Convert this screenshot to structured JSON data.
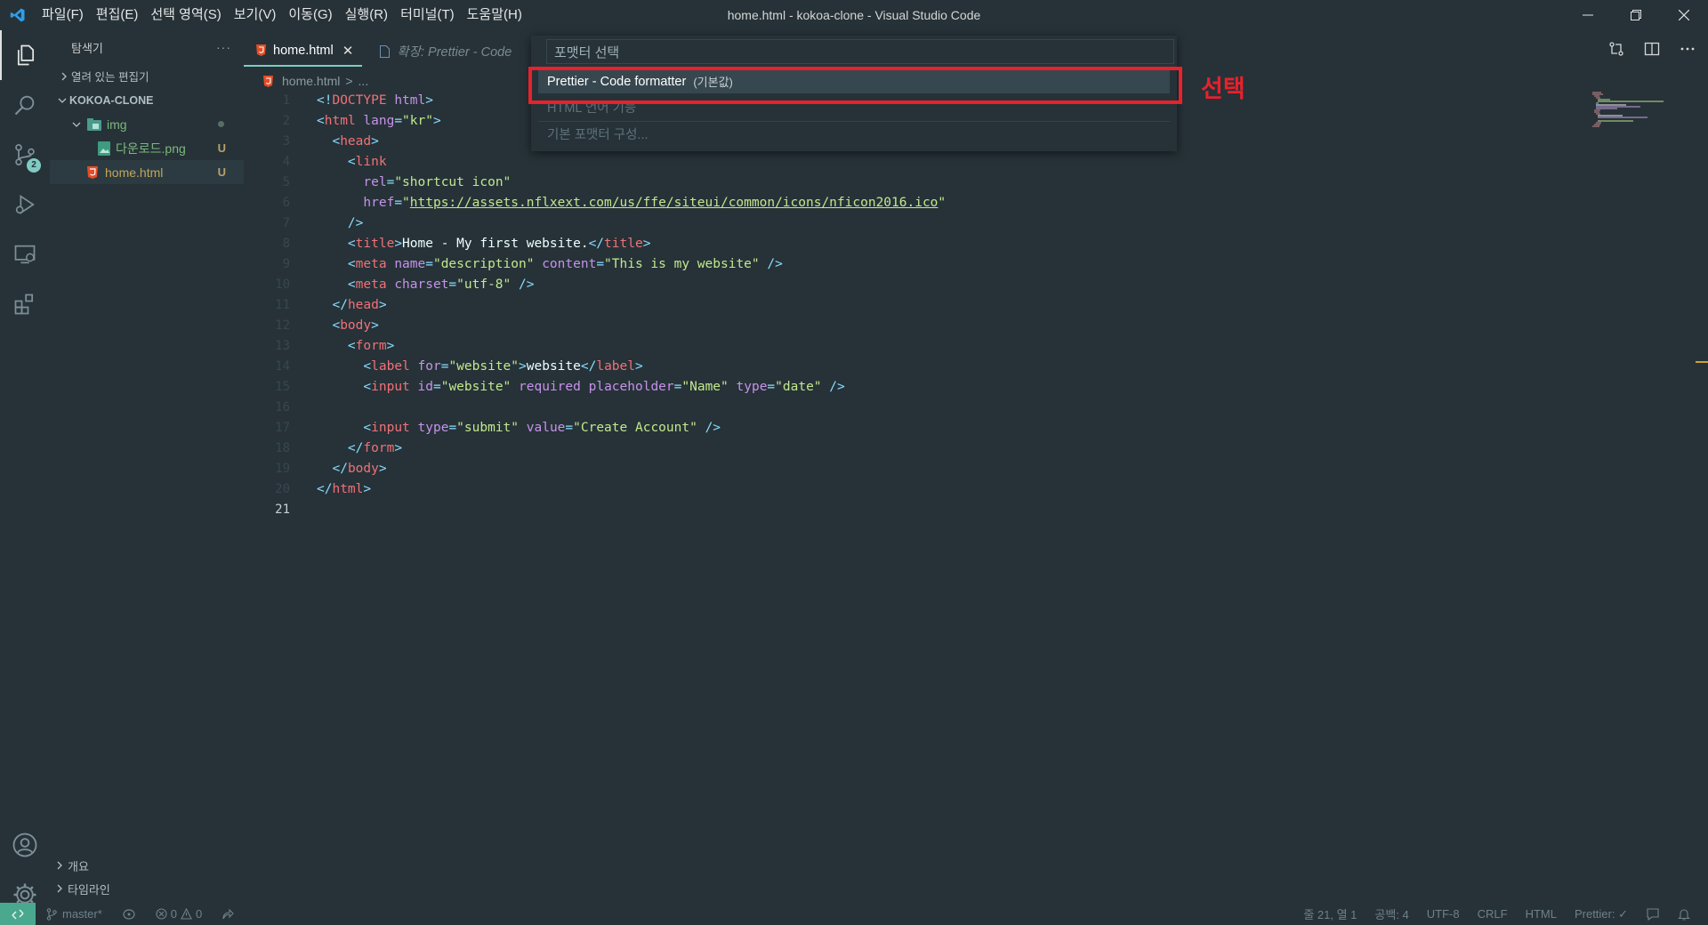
{
  "window": {
    "title": "home.html - kokoa-clone - Visual Studio Code"
  },
  "menu": {
    "items": [
      "파일(F)",
      "편집(E)",
      "선택 영역(S)",
      "보기(V)",
      "이동(G)",
      "실행(R)",
      "터미널(T)",
      "도움말(H)"
    ]
  },
  "activity_bar": {
    "scm_badge": "2"
  },
  "sidebar": {
    "title": "탐색기",
    "more": "···",
    "open_editors": "열려 있는 편집기",
    "project": "KOKOA-CLONE",
    "folder_img": "img",
    "file_png": "다운로드.png",
    "file_png_status": "U",
    "file_html": "home.html",
    "file_html_status": "U",
    "outline": "개요",
    "timeline": "타임라인"
  },
  "tabs": {
    "active_label": "home.html",
    "close_glyph": "✕",
    "preview_label": "확장: Prettier - Code"
  },
  "breadcrumb": {
    "file": "home.html",
    "separator": ">",
    "more": "..."
  },
  "code": {
    "line_numbers": [
      "1",
      "2",
      "3",
      "4",
      "5",
      "6",
      "7",
      "8",
      "9",
      "10",
      "11",
      "12",
      "13",
      "14",
      "15",
      "16",
      "17",
      "18",
      "19",
      "20",
      "21"
    ],
    "current_line": 21
  },
  "quick_pick": {
    "placeholder": "포맷터 선택",
    "items": [
      {
        "label": "Prettier - Code formatter",
        "description": "(기본값)"
      },
      {
        "label": "HTML 언어 기능",
        "description": ""
      },
      {
        "label": "기본 포맷터 구성...",
        "description": ""
      }
    ]
  },
  "annotation": {
    "label": "선택",
    "color": "#e8212b"
  },
  "statusbar": {
    "branch": "master*",
    "errors": "0",
    "warnings": "0",
    "position": "줄 21, 열 1",
    "spaces": "공백: 4",
    "encoding": "UTF-8",
    "eol": "CRLF",
    "language": "HTML",
    "formatter": "Prettier: ✓"
  },
  "colors": {
    "background": "#263238",
    "accent": "#80cbc4",
    "remote": "#4aa88f"
  }
}
